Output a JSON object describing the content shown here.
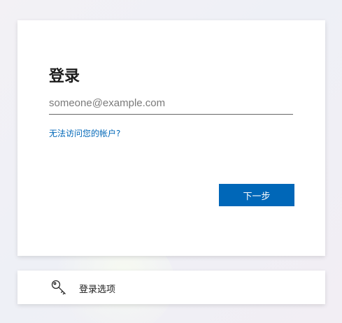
{
  "signin": {
    "title": "登录",
    "email_placeholder": "someone@example.com",
    "email_value": "",
    "cant_access_link": "无法访问您的帐户?",
    "next_button": "下一步"
  },
  "options": {
    "label": "登录选项",
    "icon": "key-icon"
  },
  "colors": {
    "accent": "#0067b8",
    "background": "#f2f2f5",
    "card": "#ffffff"
  }
}
